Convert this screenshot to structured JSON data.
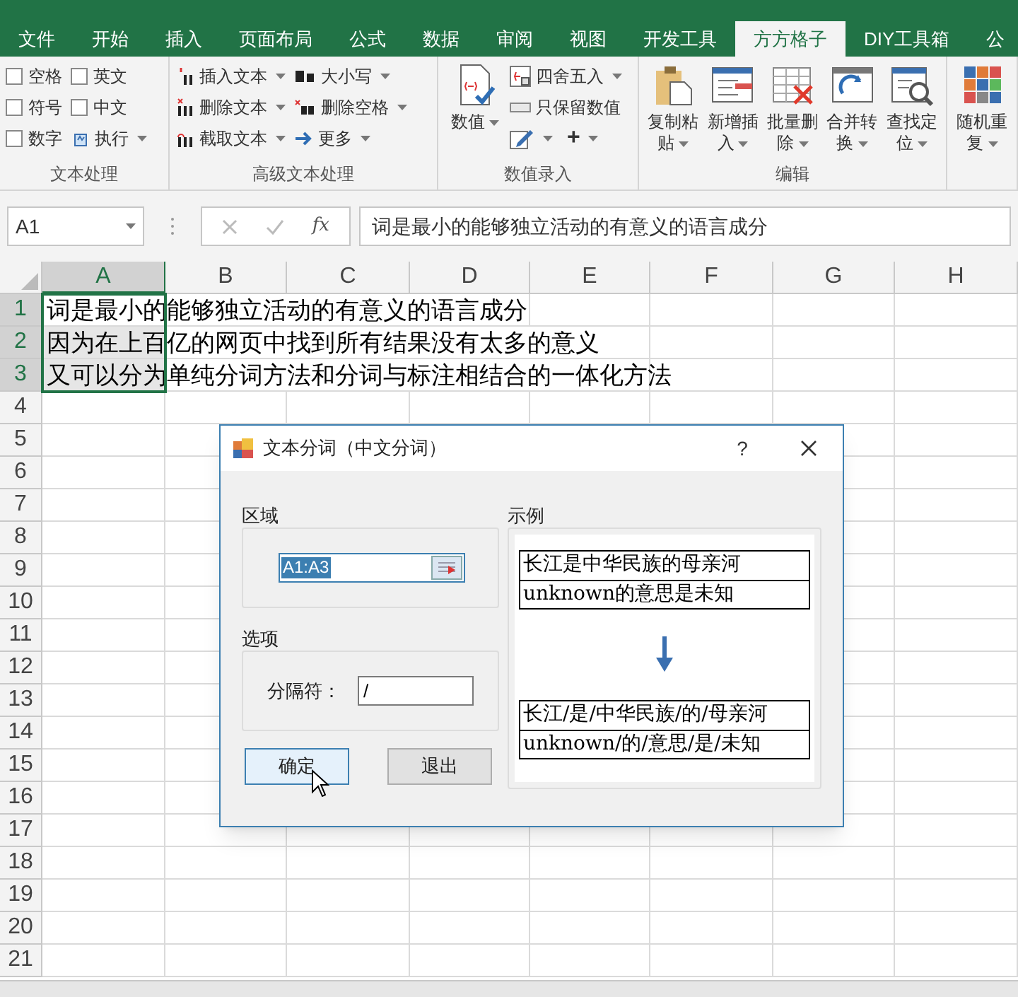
{
  "ribbon_tabs": [
    {
      "label": "文件",
      "selected": false
    },
    {
      "label": "开始",
      "selected": false
    },
    {
      "label": "插入",
      "selected": false
    },
    {
      "label": "页面布局",
      "selected": false
    },
    {
      "label": "公式",
      "selected": false
    },
    {
      "label": "数据",
      "selected": false
    },
    {
      "label": "审阅",
      "selected": false
    },
    {
      "label": "视图",
      "selected": false
    },
    {
      "label": "开发工具",
      "selected": false
    },
    {
      "label": "方方格子",
      "selected": true
    },
    {
      "label": "DIY工具箱",
      "selected": false
    },
    {
      "label": "公",
      "selected": false
    }
  ],
  "ribbon_groups": [
    {
      "label": "文本处理",
      "items": [
        {
          "kind": "checkbox",
          "label": "空格",
          "checked": false
        },
        {
          "kind": "checkbox",
          "label": "符号",
          "checked": false
        },
        {
          "kind": "checkbox",
          "label": "数字",
          "checked": false
        },
        {
          "kind": "checkbox",
          "label": "英文",
          "checked": false
        },
        {
          "kind": "checkbox",
          "label": "中文",
          "checked": false
        },
        {
          "kind": "small",
          "label": "执行",
          "dropdown": true
        }
      ]
    },
    {
      "label": "高级文本处理",
      "items": [
        {
          "kind": "small",
          "label": "插入文本",
          "dropdown": true
        },
        {
          "kind": "small",
          "label": "删除文本",
          "dropdown": true
        },
        {
          "kind": "small",
          "label": "截取文本",
          "dropdown": true
        },
        {
          "kind": "small",
          "label": "大小写",
          "dropdown": true
        },
        {
          "kind": "small",
          "label": "删除空格",
          "dropdown": true
        },
        {
          "kind": "small",
          "label": "更多",
          "dropdown": true
        }
      ]
    },
    {
      "label": "数值录入",
      "items": [
        {
          "kind": "large",
          "label": "数值",
          "dropdown": true
        },
        {
          "kind": "small",
          "label": "四舍五入",
          "dropdown": true
        },
        {
          "kind": "small",
          "label": "只保留数值",
          "dropdown": false
        },
        {
          "kind": "small",
          "dropdown": true
        },
        {
          "kind": "inline",
          "label": "+",
          "dropdown": true
        }
      ]
    },
    {
      "label": "编辑",
      "items": [
        {
          "kind": "large",
          "label": "复制粘贴",
          "dropdown": true
        },
        {
          "kind": "large",
          "label": "新增插入",
          "dropdown": true
        },
        {
          "kind": "large",
          "label": "批量删除",
          "dropdown": true
        },
        {
          "kind": "large",
          "label": "合并转换",
          "dropdown": true
        },
        {
          "kind": "large",
          "label": "查找定位",
          "dropdown": true
        }
      ]
    },
    {
      "items": [
        {
          "kind": "large",
          "label": "随机重复",
          "dropdown": true
        }
      ]
    }
  ],
  "formula_bar": {
    "name_box": "A1",
    "function_label": "fx",
    "value": "词是最小的能够独立活动的有意义的语言成分"
  },
  "sheet": {
    "columns": [
      {
        "label": "A",
        "selected": true
      },
      {
        "label": "B",
        "selected": false
      },
      {
        "label": "C",
        "selected": false
      },
      {
        "label": "D",
        "selected": false
      },
      {
        "label": "E",
        "selected": false
      },
      {
        "label": "F",
        "selected": false
      },
      {
        "label": "G",
        "selected": false
      },
      {
        "label": "H",
        "selected": false
      }
    ],
    "rows": [
      {
        "label": "1",
        "selected": true,
        "column_a": "词是最小的能够独立活动的有意义的语言成分"
      },
      {
        "label": "2",
        "selected": true,
        "column_a": "因为在上百亿的网页中找到所有结果没有太多的意义"
      },
      {
        "label": "3",
        "selected": true,
        "column_a": "又可以分为单纯分词方法和分词与标注相结合的一体化方法"
      },
      {
        "label": "4",
        "selected": false
      },
      {
        "label": "5",
        "selected": false
      },
      {
        "label": "6",
        "selected": false
      },
      {
        "label": "7",
        "selected": false
      },
      {
        "label": "8",
        "selected": false
      },
      {
        "label": "9",
        "selected": false
      },
      {
        "label": "10",
        "selected": false
      },
      {
        "label": "11",
        "selected": false
      },
      {
        "label": "12",
        "selected": false
      },
      {
        "label": "13",
        "selected": false
      },
      {
        "label": "14",
        "selected": false
      },
      {
        "label": "15",
        "selected": false
      },
      {
        "label": "16",
        "selected": false
      },
      {
        "label": "17",
        "selected": false
      },
      {
        "label": "18",
        "selected": false
      },
      {
        "label": "19",
        "selected": false
      },
      {
        "label": "20",
        "selected": false
      },
      {
        "label": "21",
        "selected": false
      }
    ]
  },
  "dialog": {
    "title": "文本分词（中文分词）",
    "help": "?",
    "range_group": {
      "label": "区域",
      "value": "A1:A3"
    },
    "options_group": {
      "label": "选项",
      "field_label": "分隔符：",
      "value": "/"
    },
    "example_group": {
      "label": "示例",
      "before": [
        "长江是中华民族的母亲河",
        "unknown的意思是未知"
      ],
      "after": [
        "长江/是/中华民族/的/母亲河",
        "unknown/的/意思/是/未知"
      ]
    },
    "buttons": [
      {
        "label": "确定",
        "default": true
      },
      {
        "label": "退出",
        "default": false
      }
    ]
  }
}
